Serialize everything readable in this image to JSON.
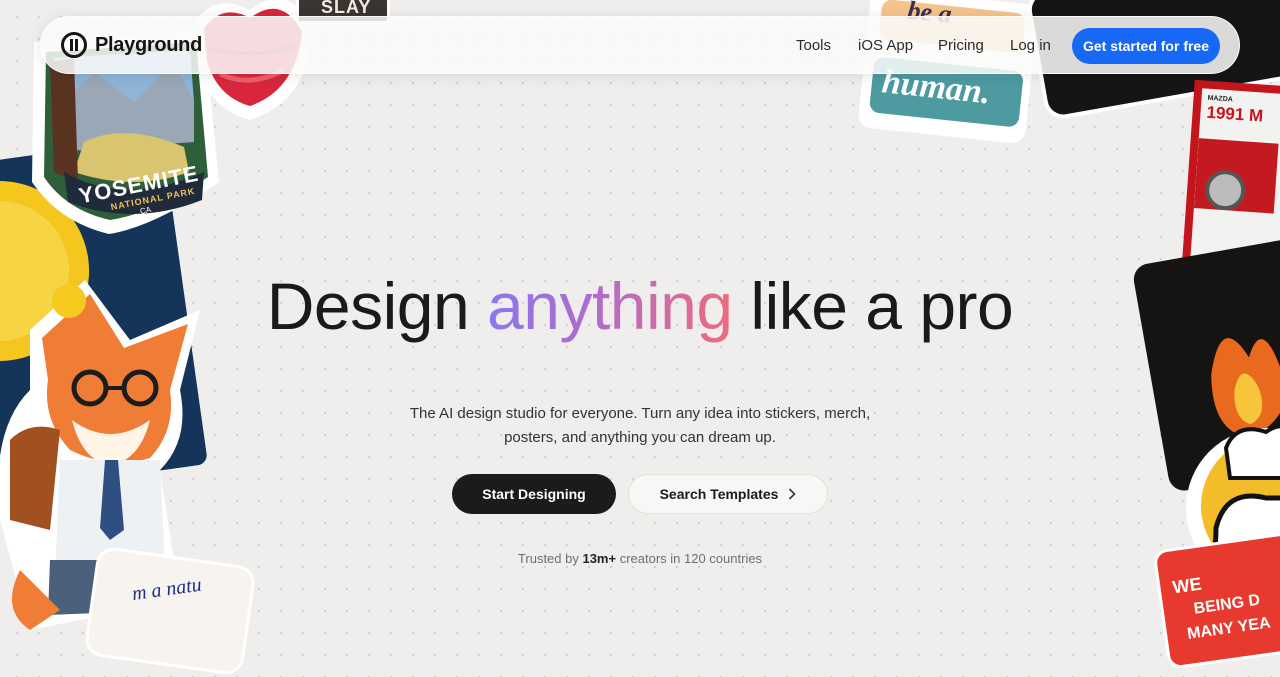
{
  "nav": {
    "brand": "Playground",
    "links": [
      "Tools",
      "iOS App",
      "Pricing",
      "Log in"
    ],
    "cta_label": "Get started for free"
  },
  "hero": {
    "headline_before": "Design ",
    "headline_highlight": "anything",
    "headline_after": " like a pro",
    "subtitle": "The AI design studio for everyone. Turn any idea into stickers, merch, posters, and anything you can dream up.",
    "primary_button": "Start Designing",
    "secondary_button": "Search Templates",
    "trust_prefix": "Trusted by ",
    "trust_count": "13m+",
    "trust_suffix": " creators in 120 countries"
  },
  "stickers": {
    "yosemite_title": "YOSEMITE",
    "yosemite_sub": "NATIONAL PARK",
    "yosemite_state": "CA",
    "slay": "SLAY",
    "be_a": "be a",
    "human": "human.",
    "car_year": "1991 M",
    "car_brand": "MAZDA",
    "nature": "m a natu",
    "poster_text_1": "WE",
    "poster_text_2": "BEING D",
    "poster_text_3": "MANY YEA"
  },
  "colors": {
    "accent": "#1769f5",
    "dark_button": "#1b1b1b",
    "gradient_start": "#8b78ef",
    "gradient_end": "#ef6b7c",
    "background": "#efeeec"
  },
  "icons": [
    "logo-icon",
    "chevron-right-icon"
  ]
}
